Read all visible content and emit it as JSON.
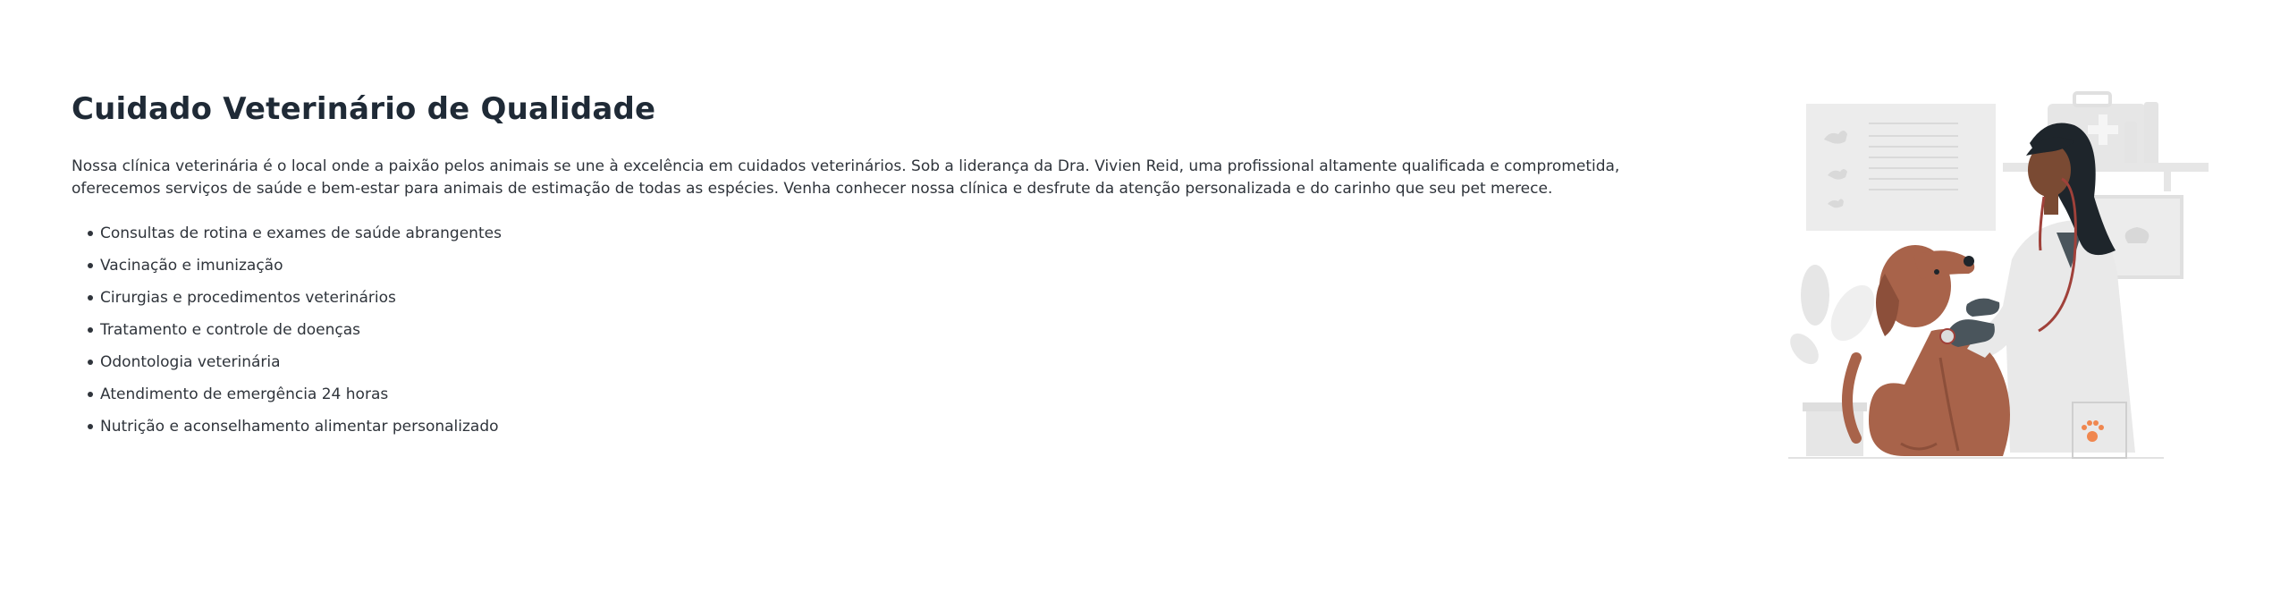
{
  "section": {
    "title": "Cuidado Veterinário de Qualidade",
    "intro": "Nossa clínica veterinária é o local onde a paixão pelos animais se une à excelência em cuidados veterinários. Sob a liderança da Dra. Vivien Reid, uma profissional altamente qualificada e comprometida, oferecemos serviços de saúde e bem-estar para animais de estimação de todas as espécies. Venha conhecer nossa clínica e desfrute da atenção personalizada e do carinho que seu pet merece.",
    "features": [
      "Consultas de rotina e exames de saúde abrangentes",
      "Vacinação e imunização",
      "Cirurgias e procedimentos veterinários",
      "Tratamento e controle de doenças",
      "Odontologia veterinária",
      "Atendimento de emergência 24 horas",
      "Nutrição e aconselhamento alimentar personalizado"
    ]
  },
  "illustration": {
    "icon": "veterinarian-with-dog-illustration",
    "colors": {
      "dog": "#a8634a",
      "skin": "#7a4a33",
      "hair": "#1e252b",
      "coat": "#e9e9e9",
      "gloves": "#4a555c",
      "accent": "#f0874f",
      "background_shapes": "#ececec"
    }
  }
}
